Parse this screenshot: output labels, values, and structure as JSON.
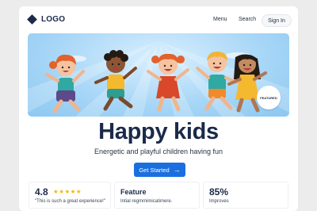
{
  "header": {
    "logo_text": "LOGO",
    "nav": [
      "Menu",
      "Search"
    ],
    "signin_label": "Sign In"
  },
  "hero": {
    "badge": "FEATURED"
  },
  "main": {
    "title": "Happy kids",
    "subtitle": "Energetic and playful children having fun",
    "cta_label": "Get Started",
    "cta_icon": "arrow-right-icon"
  },
  "stats": [
    {
      "value": "4.8",
      "rating": 5,
      "caption": "\"This is such a great experience!\""
    },
    {
      "value": "Feature",
      "caption": "Intial regmmimicatimere."
    },
    {
      "value": "85%",
      "caption": "Improves"
    }
  ],
  "colors": {
    "brand": "#1b2a4a",
    "accent": "#1a6fe0",
    "star": "#f6b800"
  }
}
